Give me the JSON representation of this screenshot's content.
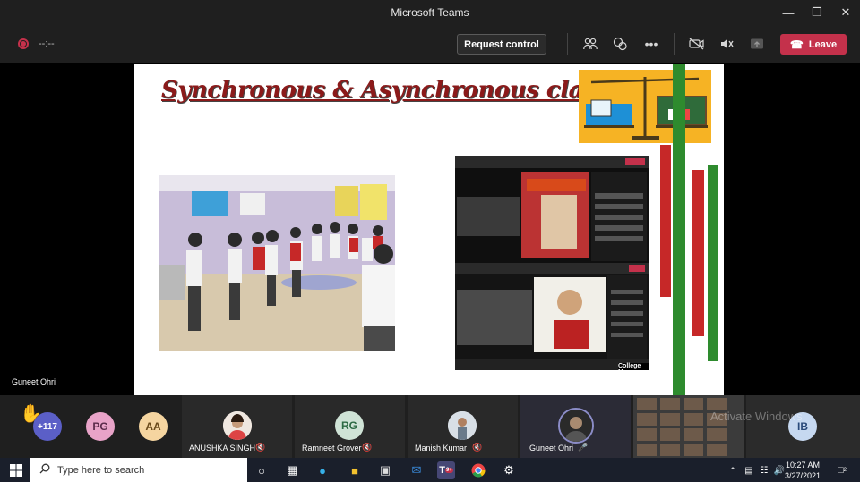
{
  "window": {
    "title": "Microsoft Teams",
    "controls": [
      "minimize",
      "maximize",
      "close"
    ]
  },
  "meeting_toolbar": {
    "timer": "--:--",
    "request_control_label": "Request control",
    "leave_label": "Leave",
    "icons": [
      "participants-icon",
      "chat-icon",
      "more-icon",
      "camera-off-icon",
      "mic-muted-icon",
      "share-icon"
    ]
  },
  "stage": {
    "slide_title": "Synchronous & Asynchronous classes",
    "screenshot_caption": "College Ma",
    "speaker_name": "Guneet Ohri"
  },
  "participants": {
    "raise_hand_count": "+117",
    "initial_avatars": [
      {
        "initials": "PG",
        "color": "#e8a3c8"
      },
      {
        "initials": "AA",
        "color": "#f5d5a0"
      }
    ],
    "tiles": [
      {
        "name": "ANUSHKA SINGH",
        "mic": "mic-off-icon"
      },
      {
        "name": "Ramneet Grover",
        "initials": "RG",
        "mic": "mic-off-icon"
      },
      {
        "name": "Manish Kumar",
        "mic": "mic-off-icon"
      },
      {
        "name": "Guneet Ohri",
        "mic": "mic-on-icon"
      }
    ],
    "last_avatar": {
      "initials": "IB",
      "color": "#c6d8f0"
    },
    "watermark": "Activate Windows"
  },
  "taskbar": {
    "search_placeholder": "Type here to search",
    "time": "10:27 AM",
    "date": "3/27/2021",
    "notification_count": "2",
    "teams_badge": "9+"
  },
  "colors": {
    "leave": "#c4314b",
    "teams_dark": "#1f1f1f",
    "slide_title": "#8b1a1a"
  }
}
